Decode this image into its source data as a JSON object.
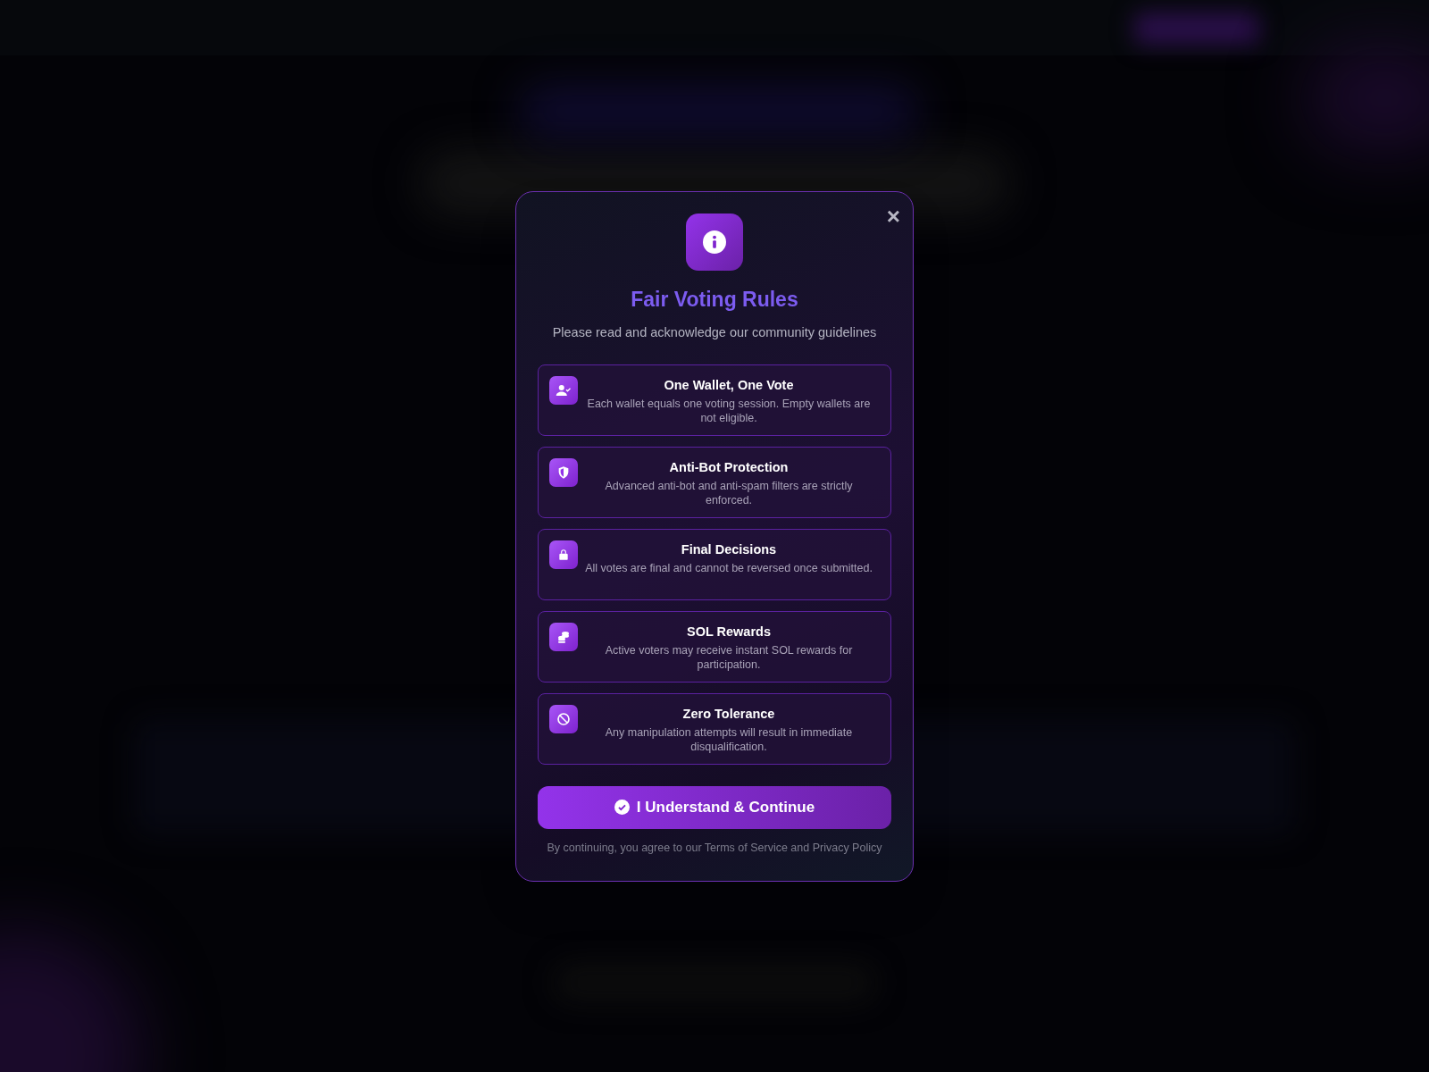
{
  "dialog": {
    "title": "Fair Voting Rules",
    "subtitle": "Please read and acknowledge our community guidelines",
    "rules": [
      {
        "kind": "user-check",
        "title": "One Wallet, One Vote",
        "text": "Each wallet equals one voting session. Empty wallets are not eligible."
      },
      {
        "kind": "shield",
        "title": "Anti-Bot Protection",
        "text": "Advanced anti-bot and anti-spam filters are strictly enforced."
      },
      {
        "kind": "lock",
        "title": "Final Decisions",
        "text": "All votes are final and cannot be reversed once submitted."
      },
      {
        "kind": "coins",
        "title": "SOL Rewards",
        "text": "Active voters may receive instant SOL rewards for participation."
      },
      {
        "kind": "ban",
        "title": "Zero Tolerance",
        "text": "Any manipulation attempts will result in immediate disqualification."
      }
    ],
    "close": "×",
    "button": "I Understand & Continue",
    "footer": "By continuing, you agree to our Terms of Service and Privacy Policy"
  }
}
